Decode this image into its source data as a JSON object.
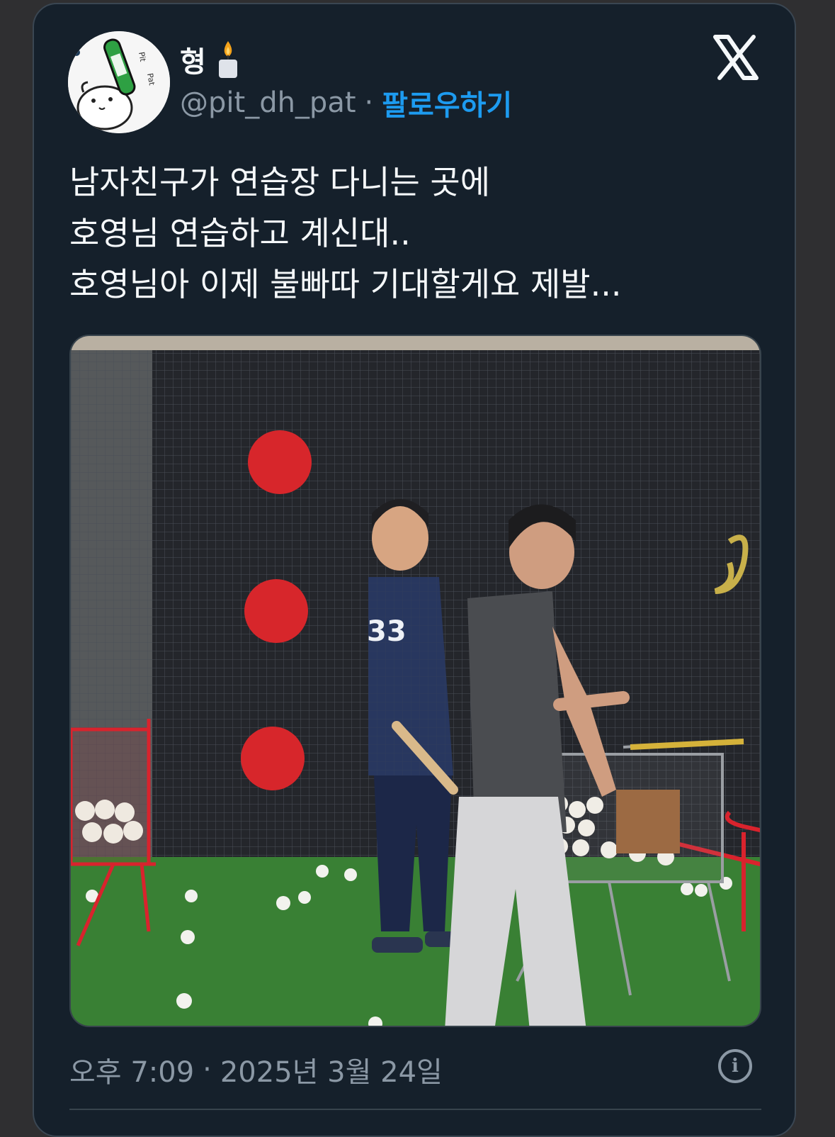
{
  "author": {
    "display_name": "형",
    "handle": "@pit_dh_pat",
    "follow_label": "팔로우하기",
    "separator": "·"
  },
  "icons": {
    "brand": "x-logo-icon",
    "status": "candle-emoji",
    "info": "info-icon"
  },
  "tweet": {
    "lines": [
      "남자친구가 연습장 다니는 곳에",
      "호영님 연습하고 계신대..",
      "호영님아 이제 불빠따 기대할게요 제발..."
    ]
  },
  "photo": {
    "jersey_number": "33"
  },
  "meta": {
    "time": "오후 7:09",
    "separator": "·",
    "date": "2025년 3월 24일"
  },
  "colors": {
    "background": "#15202b",
    "accent": "#1d9bf0",
    "text": "#f5f8fa",
    "muted": "#8b98a5"
  }
}
